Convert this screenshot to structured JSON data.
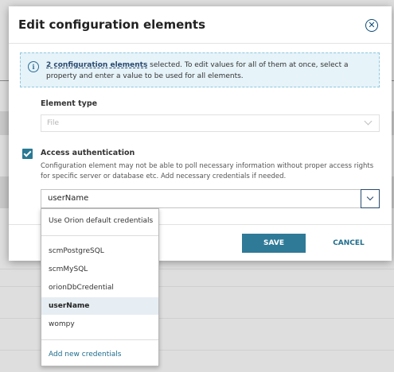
{
  "dialog": {
    "title": "Edit configuration elements",
    "close_icon": "close-circle-icon"
  },
  "info": {
    "icon": "info-icon",
    "link_text": "2 configuration elements",
    "message": " selected. To edit values for all of them at once, select a property and enter a value to be used for all elements."
  },
  "element_type": {
    "label": "Element type",
    "value": "File"
  },
  "access_auth": {
    "label": "Access authentication",
    "checked": true,
    "description": "Configuration element may not be able to poll necessary information without proper access rights for specific server or database etc. Add necessary credentials if needed.",
    "selected_value": "userName"
  },
  "credentials_dropdown": {
    "default_option": "Use Orion default credentials",
    "options": [
      "scmPostgreSQL",
      "scmMySQL",
      "orionDbCredential",
      "userName",
      "wompy"
    ],
    "selected": "userName",
    "add_link": "Add new credentials"
  },
  "footer": {
    "save_label": "SAVE",
    "cancel_label": "CANCEL"
  },
  "colors": {
    "accent": "#2f7a97",
    "checkbox": "#297994",
    "link": "#1e6c8c",
    "info_bg": "#e6f3f9"
  }
}
